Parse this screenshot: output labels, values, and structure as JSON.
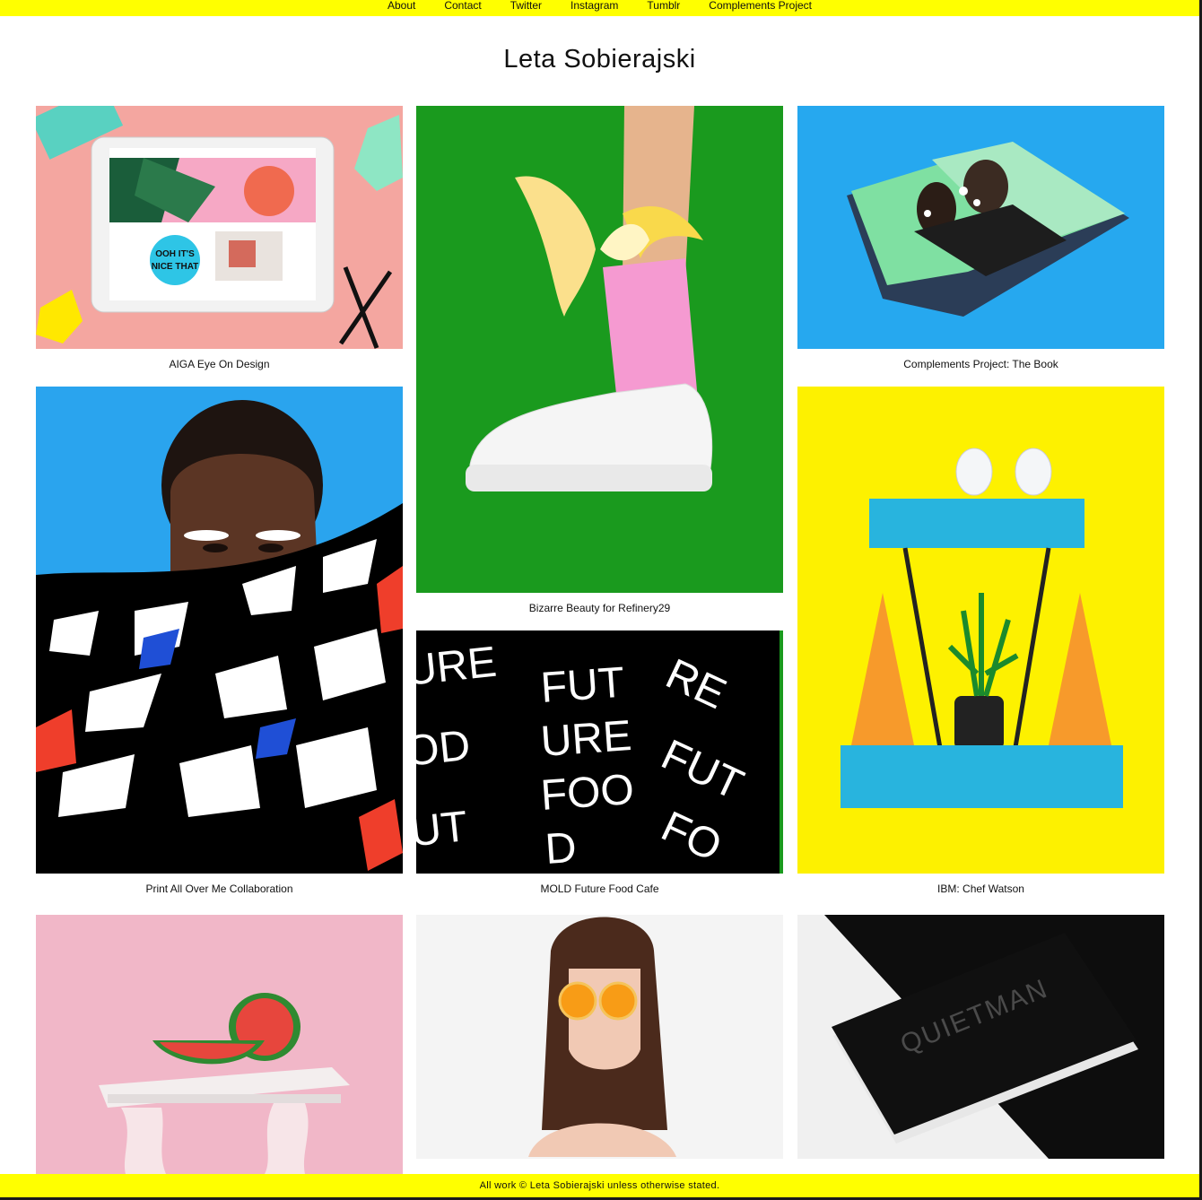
{
  "nav": {
    "links": [
      "About",
      "Contact",
      "Twitter",
      "Instagram",
      "Tumblr",
      "Complements Project"
    ]
  },
  "site": {
    "title": "Leta Sobierajski"
  },
  "projects": [
    {
      "caption": "AIGA Eye On Design",
      "bg": "#f4a6a0",
      "tablet_text": "OOH IT'S NICE THAT"
    },
    {
      "caption": "Bizarre Beauty for Refinery29",
      "bg": "#1a9a1e"
    },
    {
      "caption": "Complements Project: The Book",
      "bg": "#26a8ef"
    },
    {
      "caption": "Print All Over Me Collaboration",
      "bg": "#2aa4ee"
    },
    {
      "caption": "MOLD Future Food Cafe",
      "bg": "#000000",
      "poster_text": "FUTURE FOOD"
    },
    {
      "caption": "IBM: Chef Watson",
      "bg": "#fdf100"
    },
    {
      "caption": "",
      "bg": "#f1b7c8"
    },
    {
      "caption": "",
      "bg": "#f4f4f4"
    },
    {
      "caption": "",
      "bg": "#f0f0f0",
      "card_text": "QUIETMAN"
    }
  ],
  "footer": {
    "text": "All work © Leta Sobierajski unless otherwise stated."
  },
  "colors": {
    "accent": "#ffff00",
    "text": "#111111"
  }
}
